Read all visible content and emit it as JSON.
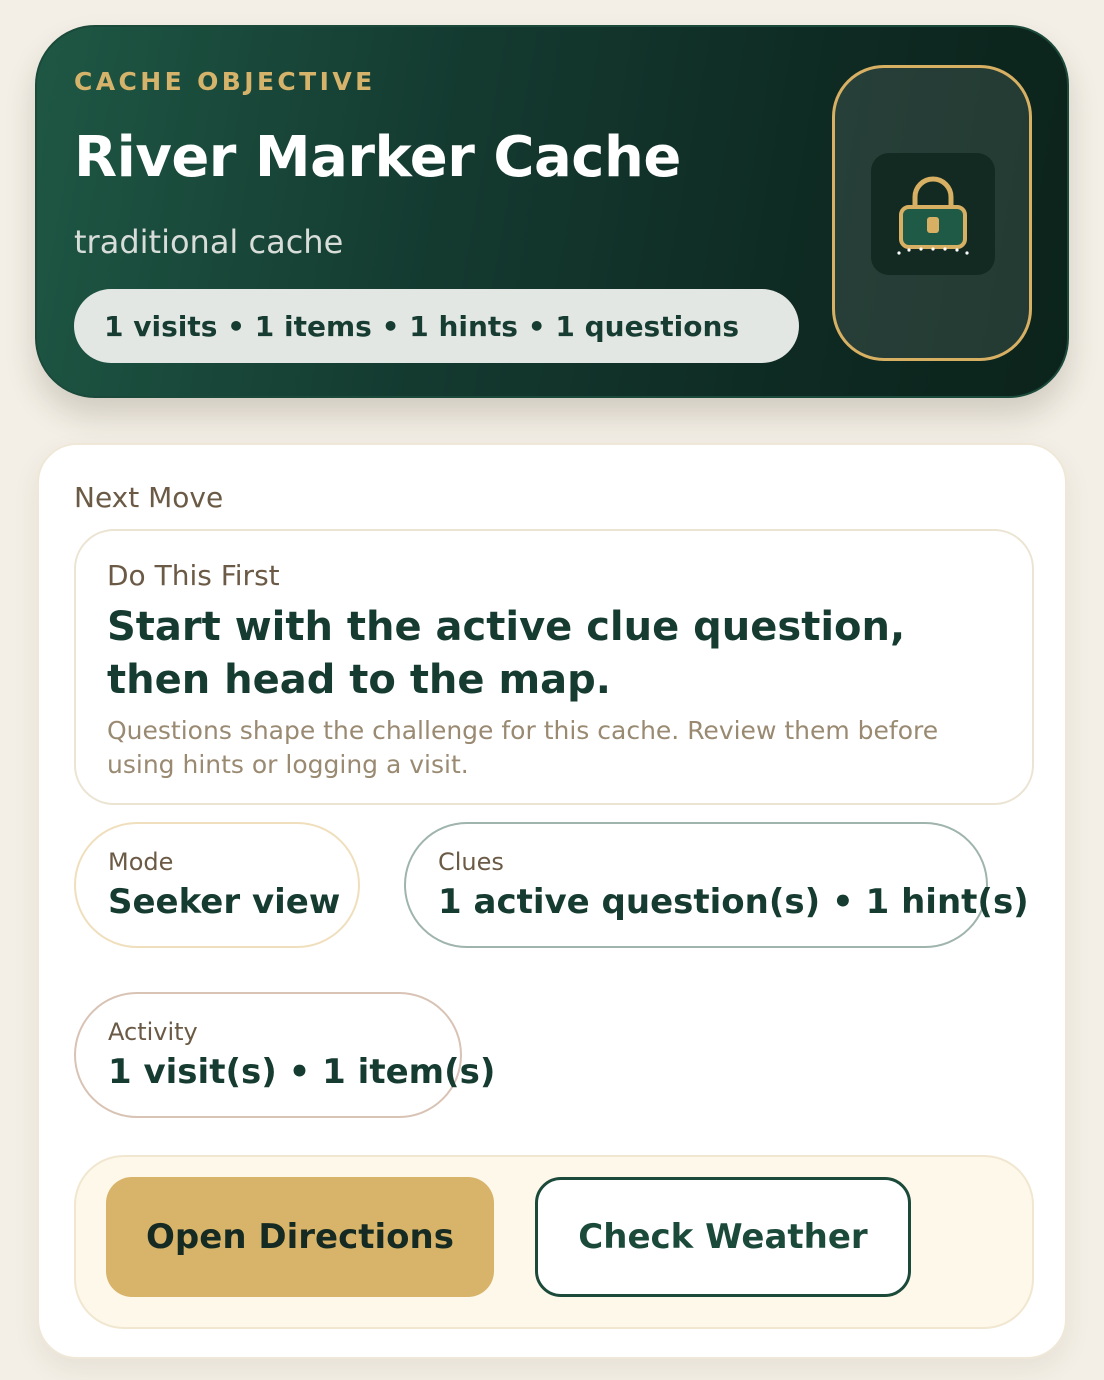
{
  "hero": {
    "eyebrow": "CACHE OBJECTIVE",
    "title": "River Marker Cache",
    "subtitle": "traditional cache",
    "stats": "1 visits • 1 items • 1 hints • 1 questions",
    "icon": "lock-icon",
    "colors": {
      "accent": "#d7b063",
      "background": "#143a30"
    }
  },
  "next_move": {
    "label": "Next Move",
    "first": {
      "label": "Do This First",
      "title": "Start with the active clue question, then head to the map.",
      "body": "Questions shape the challenge for this cache. Review them before using hints or logging a visit."
    },
    "chips": {
      "mode": {
        "label": "Mode",
        "value": "Seeker view"
      },
      "clues": {
        "label": "Clues",
        "value": "1 active question(s) • 1 hint(s)"
      },
      "activity": {
        "label": "Activity",
        "value": "1 visit(s) • 1 item(s)"
      }
    },
    "actions": {
      "primary": "Open Directions",
      "secondary": "Check Weather"
    }
  }
}
